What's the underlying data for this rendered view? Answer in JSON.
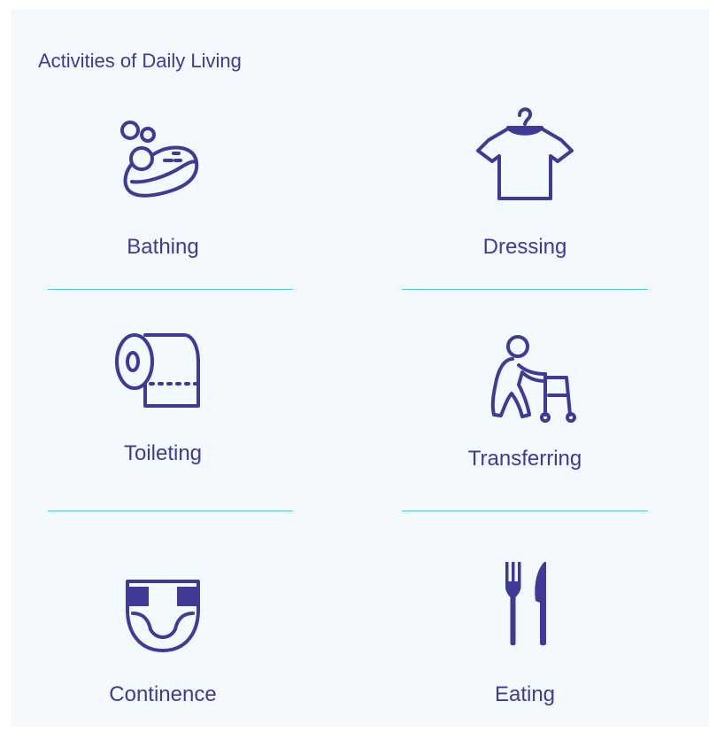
{
  "title": "Activities of Daily Living",
  "colors": {
    "ink": "#3f3a98",
    "divider": "#4fc6da",
    "panel": "#f3f9fd"
  },
  "activities": [
    {
      "label": "Bathing",
      "icon": "soap-icon"
    },
    {
      "label": "Dressing",
      "icon": "shirt-on-hanger-icon"
    },
    {
      "label": "Toileting",
      "icon": "toilet-paper-icon"
    },
    {
      "label": "Transferring",
      "icon": "person-with-walker-icon"
    },
    {
      "label": "Continence",
      "icon": "diaper-icon"
    },
    {
      "label": "Eating",
      "icon": "fork-and-knife-icon"
    }
  ]
}
